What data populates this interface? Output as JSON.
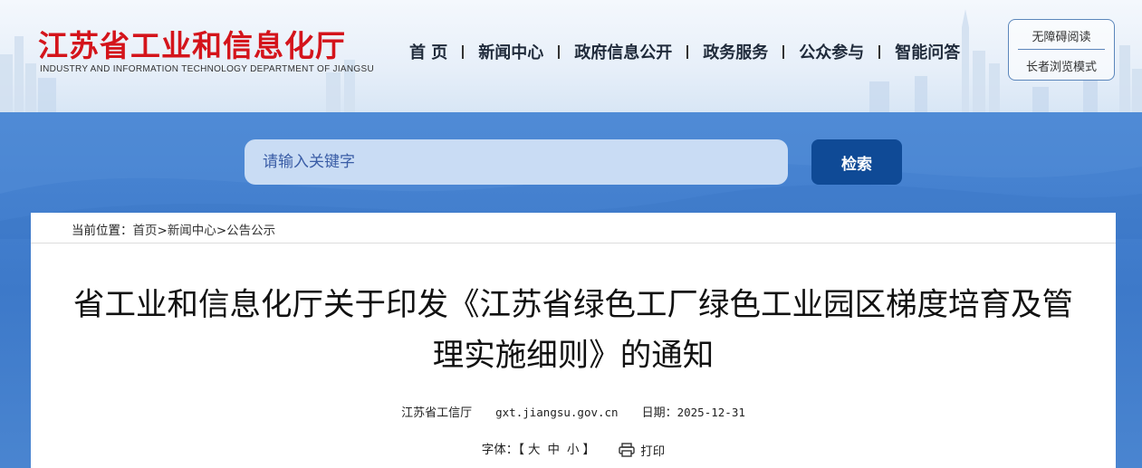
{
  "header": {
    "logo_cn": "江苏省工业和信息化厅",
    "logo_en": "INDUSTRY AND INFORMATION TECHNOLOGY DEPARTMENT OF JIANGSU",
    "nav": [
      "首 页",
      "新闻中心",
      "政府信息公开",
      "政务服务",
      "公众参与",
      "智能问答"
    ],
    "accessibility": "无障碍阅读",
    "elder_mode": "长者浏览模式"
  },
  "search": {
    "placeholder": "请输入关键字",
    "button": "检索"
  },
  "breadcrumb": {
    "prefix": "当前位置：",
    "items": [
      "首页",
      "新闻中心",
      "公告公示"
    ],
    "separator": ">"
  },
  "article": {
    "title": "省工业和信息化厅关于印发《江苏省绿色工厂绿色工业园区梯度培育及管理实施细则》的通知",
    "source": "江苏省工信厅",
    "site": "gxt.jiangsu.gov.cn",
    "date_label": "日期：",
    "date": "2025-12-31",
    "font_label": "字体：",
    "font_open": "【",
    "font_sizes": [
      "大",
      "中",
      "小"
    ],
    "font_close": "】",
    "print": "打印"
  },
  "colors": {
    "brand_red": "#d4141b",
    "band_blue": "#3d79c9",
    "button_blue": "#0f4a96"
  }
}
